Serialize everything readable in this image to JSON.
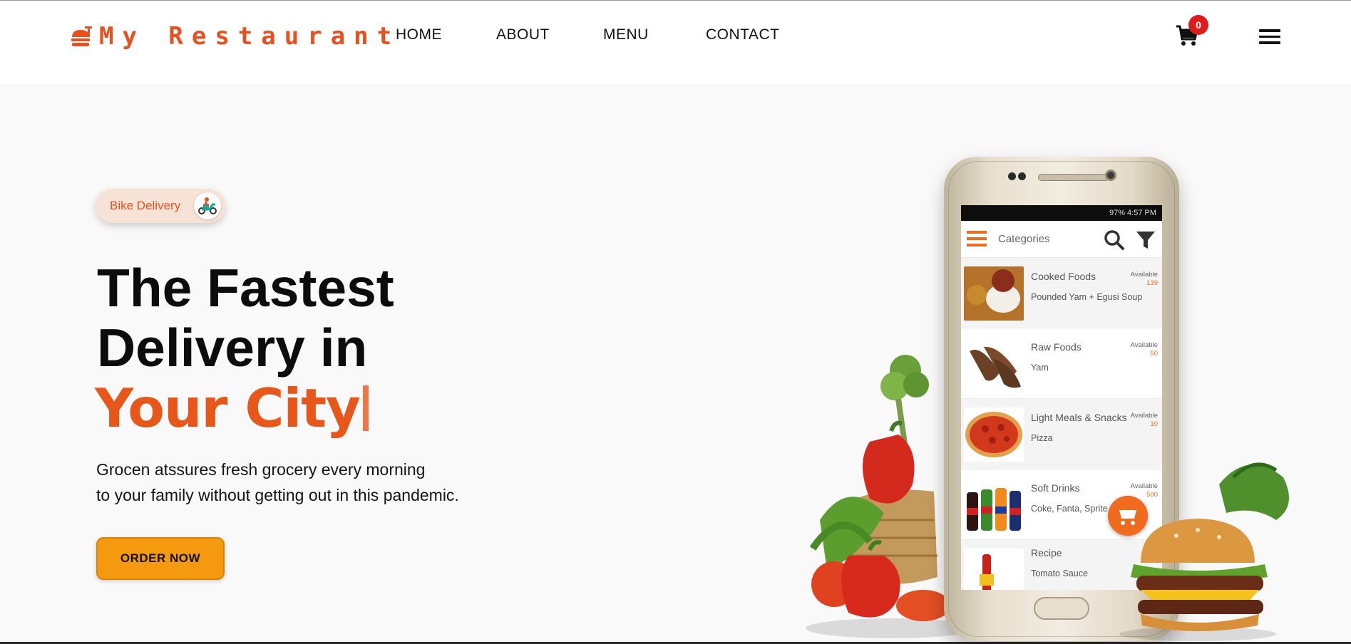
{
  "header": {
    "brand": "My Restaurant",
    "brand_color": "#e8501e",
    "nav": [
      {
        "label": "HOME"
      },
      {
        "label": "ABOUT"
      },
      {
        "label": "MENU"
      },
      {
        "label": "CONTACT"
      }
    ],
    "cart_count": "0",
    "cart_icon": "cart-icon",
    "menu_icon": "hamburger-icon"
  },
  "hero": {
    "badge_label": "Bike Delivery",
    "badge_icon": "scooter-icon",
    "headline_line1": "The Fastest",
    "headline_line2": "Delivery in",
    "headline_accent": "Your City",
    "accent_color": "#e8571a",
    "description_line1": "Grocen atssures fresh grocery every morning",
    "description_line2": "to your family without getting out in this pandemic.",
    "cta_label": "ORDER NOW",
    "cta_color": "#f59a0f"
  },
  "phone_app": {
    "status": "97%  4:57 PM",
    "title": "Categories",
    "items": [
      {
        "category": "Cooked Foods",
        "item": "Pounded Yam + Egusi Soup",
        "available_label": "Available",
        "count": "139"
      },
      {
        "category": "Raw Foods",
        "item": "Yam",
        "available_label": "Available",
        "count": "50"
      },
      {
        "category": "Light Meals & Snacks",
        "item": "Pizza",
        "available_label": "Available",
        "count": "10"
      },
      {
        "category": "Soft Drinks",
        "item": "Coke, Fanta, Sprite",
        "available_label": "Available",
        "count": "500"
      },
      {
        "category": "Recipe",
        "item": "Tomato Sauce",
        "available_label": "",
        "count": ""
      }
    ]
  }
}
